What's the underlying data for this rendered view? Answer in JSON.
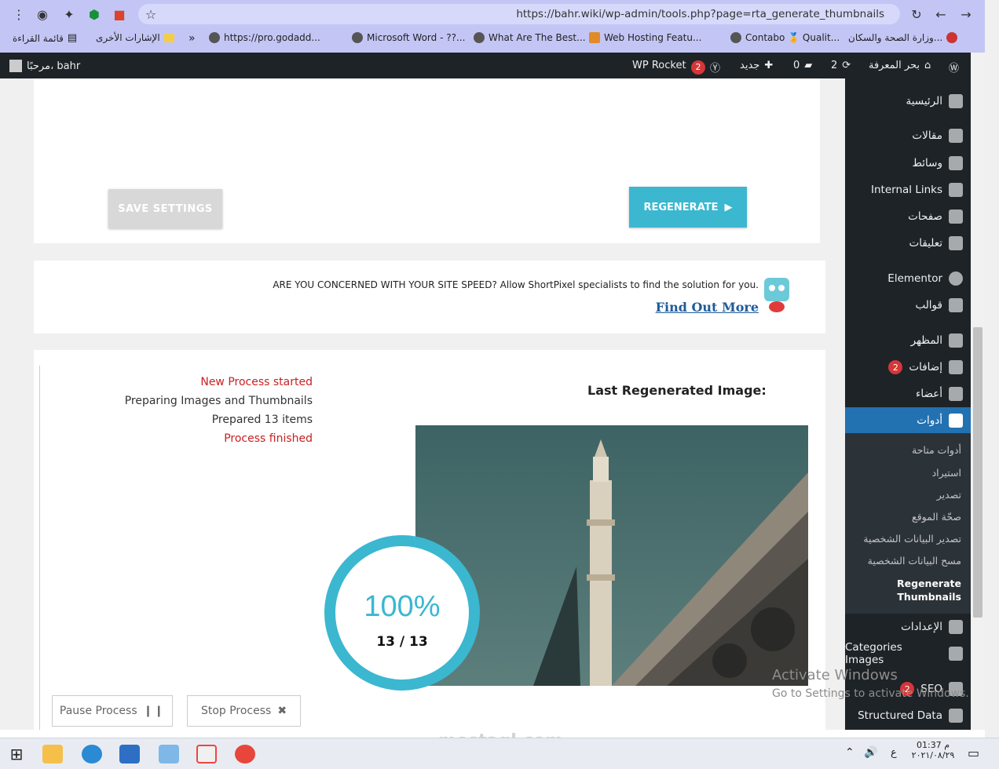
{
  "browser": {
    "url": "https://bahr.wiki/wp-admin/tools.php?page=rta_generate_thumbnails",
    "bookmarks": [
      {
        "label": "وزارة الصحة والسكان..."
      },
      {
        "label": "Contabo 🏅 Qualit..."
      },
      {
        "label": "Web Hosting Featu..."
      },
      {
        "label": "What Are The Best..."
      },
      {
        "label": "Microsoft Word - ??..."
      },
      {
        "label": "https://pro.godadd..."
      },
      {
        "label": "»"
      },
      {
        "label": "الإشارات الأخرى"
      },
      {
        "label": "قائمة القراءة"
      }
    ]
  },
  "adminbar": {
    "site_name": "بحر المعرفة",
    "updates_count": "2",
    "comments_count": "0",
    "new_label": "جديد",
    "yoast_badge": "2",
    "wp_rocket": "WP Rocket",
    "greeting": "مرحبًا، bahr"
  },
  "sidebar": {
    "items": [
      {
        "label": "الرئيسية",
        "icon": "dashboard-icon"
      },
      {
        "label": "مقالات",
        "icon": "pin-icon"
      },
      {
        "label": "وسائط",
        "icon": "media-icon"
      },
      {
        "label": "Internal Links",
        "icon": "link-icon"
      },
      {
        "label": "صفحات",
        "icon": "page-icon"
      },
      {
        "label": "تعليقات",
        "icon": "comment-icon"
      },
      {
        "label": "Elementor",
        "icon": "elementor-icon"
      },
      {
        "label": "قوالب",
        "icon": "folder-icon"
      },
      {
        "label": "المظهر",
        "icon": "brush-icon"
      },
      {
        "label": "إضافات",
        "icon": "plugin-icon",
        "badge": "2"
      },
      {
        "label": "أعضاء",
        "icon": "user-icon"
      },
      {
        "label": "أدوات",
        "icon": "wrench-icon"
      },
      {
        "label": "الإعدادات",
        "icon": "settings-icon"
      },
      {
        "label": "Categories Images",
        "icon": "image-icon"
      },
      {
        "label": "SEO",
        "icon": "yoast-icon",
        "badge": "2"
      },
      {
        "label": "Structured Data",
        "icon": "pin-icon"
      }
    ],
    "submenu": [
      "أدوات متاحة",
      "استيراد",
      "تصدير",
      "صحّة الموقع",
      "تصدير البيانات الشخصية",
      "مسح البيانات الشخصية",
      "Regenerate Thumbnails"
    ]
  },
  "actions": {
    "save_label": "SAVE SETTINGS",
    "regenerate_label": "REGENERATE"
  },
  "promo": {
    "text": "ARE YOU CONCERNED WITH YOUR SITE SPEED? Allow ShortPixel specialists to find the solution for you.",
    "link": "Find Out More"
  },
  "process": {
    "title": "Last Regenerated Image:",
    "log": [
      {
        "text": "New Process started",
        "color": "#c92020"
      },
      {
        "text": "Preparing Images and Thumbnails",
        "color": "#333333"
      },
      {
        "text": "Prepared 13 items",
        "color": "#333333"
      },
      {
        "text": "Process finished",
        "color": "#c92020"
      }
    ],
    "percent": "100%",
    "progress_value": 1.0,
    "count": "13 / 13",
    "pause_label": "Pause Process",
    "stop_label": "Stop Process"
  },
  "watermark": {
    "activate": "Activate Windows",
    "goto": "Go to Settings to activate Windows.",
    "site_text": "mostaql.com"
  },
  "taskbar": {
    "time": "01:37 م",
    "date": "٢٠٢١/٠٨/٢٩",
    "lang": "ع"
  },
  "colors": {
    "accent": "#3bb7d0",
    "wp_blue": "#2271b1",
    "admin_dark": "#1d2327"
  }
}
